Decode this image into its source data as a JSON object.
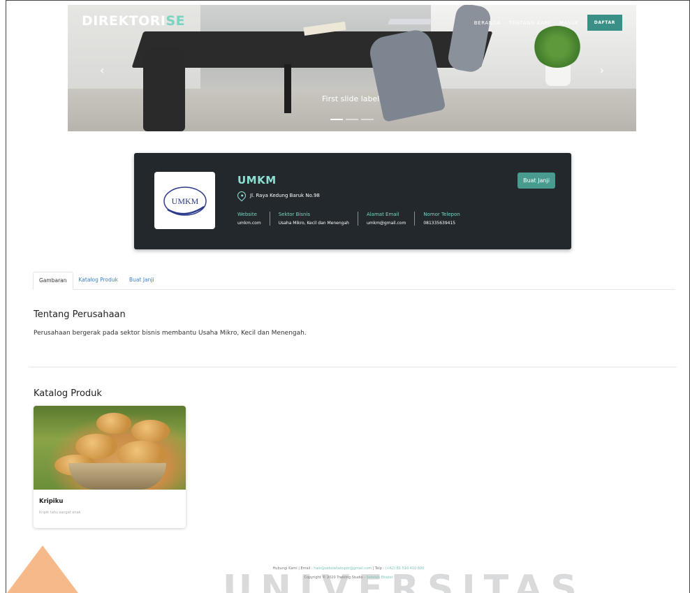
{
  "header": {
    "brand_main": "DIREKTORI",
    "brand_accent": "SE",
    "nav": [
      "BERANDA",
      "TENTANG KAMI",
      "MASUK"
    ],
    "signup": "DAFTAR"
  },
  "carousel": {
    "slide_label": "First slide label",
    "prev_icon": "‹",
    "next_icon": "›",
    "slide_count": 3,
    "active_slide": 1
  },
  "company": {
    "logo_text": "UMKM",
    "name": "UMKM",
    "address": "Jl. Raya Kedung Baruk No.98",
    "appointment_button": "Buat Janji",
    "info": [
      {
        "label": "Website",
        "value": "umkm.com"
      },
      {
        "label": "Sektor Bisnis",
        "value": "Usaha Mikro, Kecil dan Menengah"
      },
      {
        "label": "Alamat Email",
        "value": "umkm@gmail.com"
      },
      {
        "label": "Nomor Telepon",
        "value": "081335639415"
      }
    ]
  },
  "tabs": [
    "Gambaran",
    "Katalog Produk",
    "Buat Janji"
  ],
  "about": {
    "title": "Tentang Perusahaan",
    "text": "Perusahaan bergerak pada sektor bisnis membantu Usaha Mikro, Kecil dan Menengah."
  },
  "catalog": {
    "title": "Katalog Produk",
    "products": [
      {
        "name": "Kripiku",
        "description": "Kripik tahu sangat enak"
      }
    ]
  },
  "footer": {
    "contact_prefix": "Hubungi Kami | Email : ",
    "email": "halo@sekolahekspor@gmail.com",
    "phone_prefix": " | Telp : ",
    "phone": "(+62) 81 510 410 600",
    "copyright_prefix": "Copyright © 2020 Training Studio - ",
    "copyright_link": "Sekolah Ekspor"
  },
  "watermark": "UNIVERSITAS",
  "colors": {
    "accent": "#7bd3c3",
    "button": "#4a9b8f",
    "card_bg": "#23282d",
    "link": "#3f80c3"
  }
}
